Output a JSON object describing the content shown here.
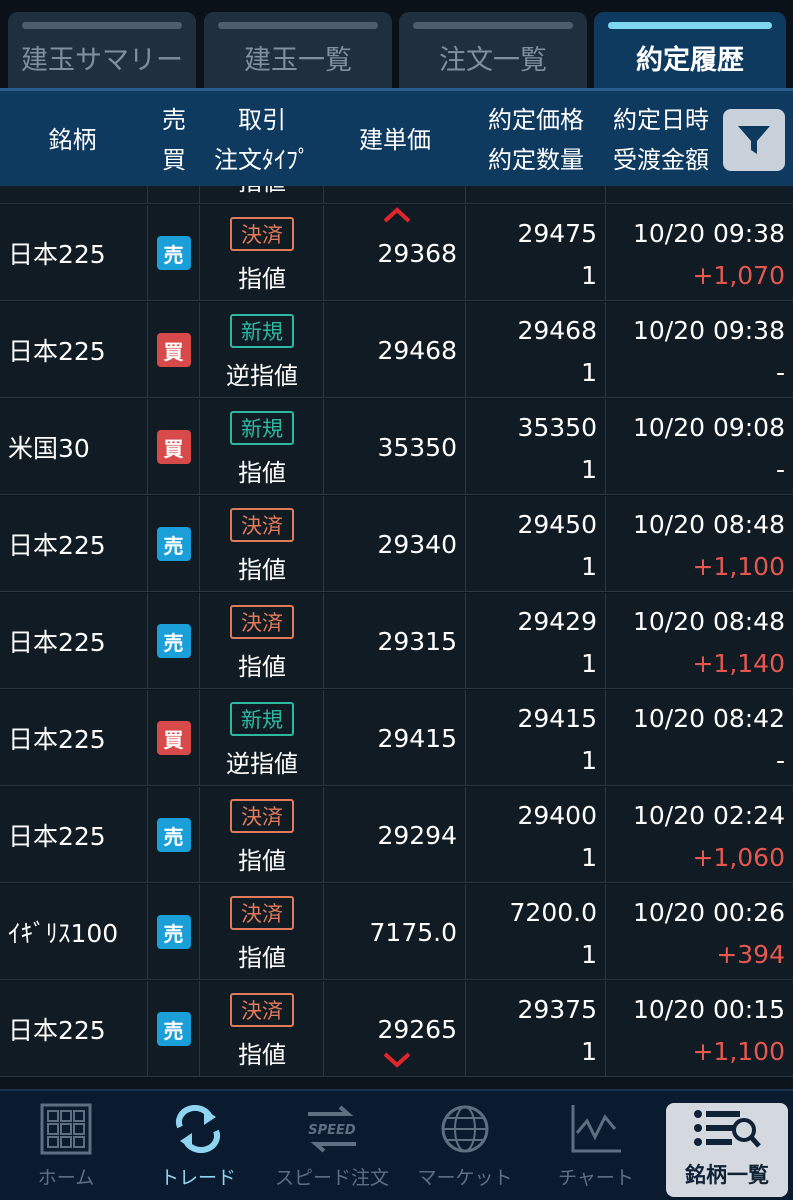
{
  "tabs": [
    {
      "label": "建玉サマリー",
      "active": false
    },
    {
      "label": "建玉一覧",
      "active": false
    },
    {
      "label": "注文一覧",
      "active": false
    },
    {
      "label": "約定履歴",
      "active": true
    }
  ],
  "header": {
    "symbol": "銘柄",
    "side_top": "売",
    "side_bottom": "買",
    "trade_top": "取引",
    "trade_bottom": "注文ﾀｲﾌﾟ",
    "entry_price": "建単価",
    "exec_price": "約定価格",
    "exec_qty": "約定数量",
    "exec_datetime": "約定日時",
    "settle_amount": "受渡金額",
    "filter_icon": "filter-icon"
  },
  "partial_row": {
    "ordtype": "指値"
  },
  "rows": [
    {
      "name": "日本225",
      "side": "売",
      "side_kind": "sell",
      "tag": "決済",
      "tag_kind": "close",
      "ordtype": "指値",
      "entry_price": "29368",
      "exec_price": "29475",
      "qty": "1",
      "datetime": "10/20 09:38",
      "amount": "+1,070"
    },
    {
      "name": "日本225",
      "side": "買",
      "side_kind": "buy",
      "tag": "新規",
      "tag_kind": "new",
      "ordtype": "逆指値",
      "entry_price": "29468",
      "exec_price": "29468",
      "qty": "1",
      "datetime": "10/20 09:38",
      "amount": "-"
    },
    {
      "name": "米国30",
      "side": "買",
      "side_kind": "buy",
      "tag": "新規",
      "tag_kind": "new",
      "ordtype": "指値",
      "entry_price": "35350",
      "exec_price": "35350",
      "qty": "1",
      "datetime": "10/20 09:08",
      "amount": "-"
    },
    {
      "name": "日本225",
      "side": "売",
      "side_kind": "sell",
      "tag": "決済",
      "tag_kind": "close",
      "ordtype": "指値",
      "entry_price": "29340",
      "exec_price": "29450",
      "qty": "1",
      "datetime": "10/20 08:48",
      "amount": "+1,100"
    },
    {
      "name": "日本225",
      "side": "売",
      "side_kind": "sell",
      "tag": "決済",
      "tag_kind": "close",
      "ordtype": "指値",
      "entry_price": "29315",
      "exec_price": "29429",
      "qty": "1",
      "datetime": "10/20 08:48",
      "amount": "+1,140"
    },
    {
      "name": "日本225",
      "side": "買",
      "side_kind": "buy",
      "tag": "新規",
      "tag_kind": "new",
      "ordtype": "逆指値",
      "entry_price": "29415",
      "exec_price": "29415",
      "qty": "1",
      "datetime": "10/20 08:42",
      "amount": "-"
    },
    {
      "name": "日本225",
      "side": "売",
      "side_kind": "sell",
      "tag": "決済",
      "tag_kind": "close",
      "ordtype": "指値",
      "entry_price": "29294",
      "exec_price": "29400",
      "qty": "1",
      "datetime": "10/20 02:24",
      "amount": "+1,060"
    },
    {
      "name": "ｲｷﾞﾘｽ100",
      "side": "売",
      "side_kind": "sell",
      "tag": "決済",
      "tag_kind": "close",
      "ordtype": "指値",
      "entry_price": "7175.0",
      "exec_price": "7200.0",
      "qty": "1",
      "datetime": "10/20 00:26",
      "amount": "+394"
    },
    {
      "name": "日本225",
      "side": "売",
      "side_kind": "sell",
      "tag": "決済",
      "tag_kind": "close",
      "ordtype": "指値",
      "entry_price": "29265",
      "exec_price": "29375",
      "qty": "1",
      "datetime": "10/20 00:15",
      "amount": "+1,100"
    }
  ],
  "nav": [
    {
      "label": "ホーム",
      "icon": "home-grid-icon"
    },
    {
      "label": "トレード",
      "icon": "trade-cycle-icon",
      "active": true
    },
    {
      "label": "スピード注文",
      "icon": "speed-order-icon"
    },
    {
      "label": "マーケット",
      "icon": "market-globe-icon"
    },
    {
      "label": "チャート",
      "icon": "chart-icon"
    },
    {
      "label": "銘柄一覧",
      "icon": "symbol-list-icon",
      "boxed": true
    }
  ],
  "colors": {
    "sell": "#1b9fd8",
    "buy": "#d84a4a",
    "close_tag": "#e07a5a",
    "new_tag": "#2fb8a0",
    "profit": "#e6584f",
    "header_bg": "#0f3a60"
  }
}
